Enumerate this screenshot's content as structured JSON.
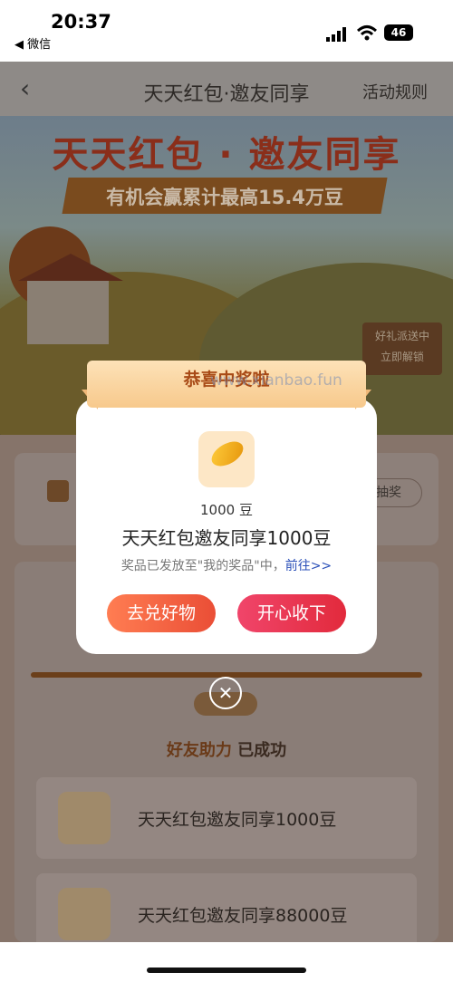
{
  "status_bar": {
    "time": "20:37",
    "back_app": "◀ 微信",
    "battery": "46"
  },
  "nav": {
    "back_icon": "chevron-left-icon",
    "title": "天天红包·邀友同享",
    "rules": "活动规则"
  },
  "hero": {
    "title": "天天红包 · 邀友同享",
    "subtitle": "有机会赢累计最高15.4万豆",
    "sign_line1": "好礼派送中",
    "sign_line2": "立即解锁"
  },
  "card": {
    "lottery_button": "抽奖"
  },
  "friends": {
    "title_prefix": "好友助力",
    "title_suffix": "已成功",
    "items": [
      {
        "name": "天天红包邀友同享1000豆"
      },
      {
        "name": "天天红包邀友同享88000豆"
      }
    ]
  },
  "modal": {
    "ribbon": "恭喜中奖啦",
    "watermark": "www.xianbao.fun",
    "amount": "1000 豆",
    "prize_name": "天天红包邀友同享1000豆",
    "notice": "奖品已发放至\"我的奖品\"中，",
    "notice_link": "前往>>",
    "exchange_button": "去兑好物",
    "accept_button": "开心收下",
    "close": "✕"
  },
  "colors": {
    "accent": "#ea4e36",
    "accent2": "#e22a3c",
    "link": "#2a4fb8"
  }
}
